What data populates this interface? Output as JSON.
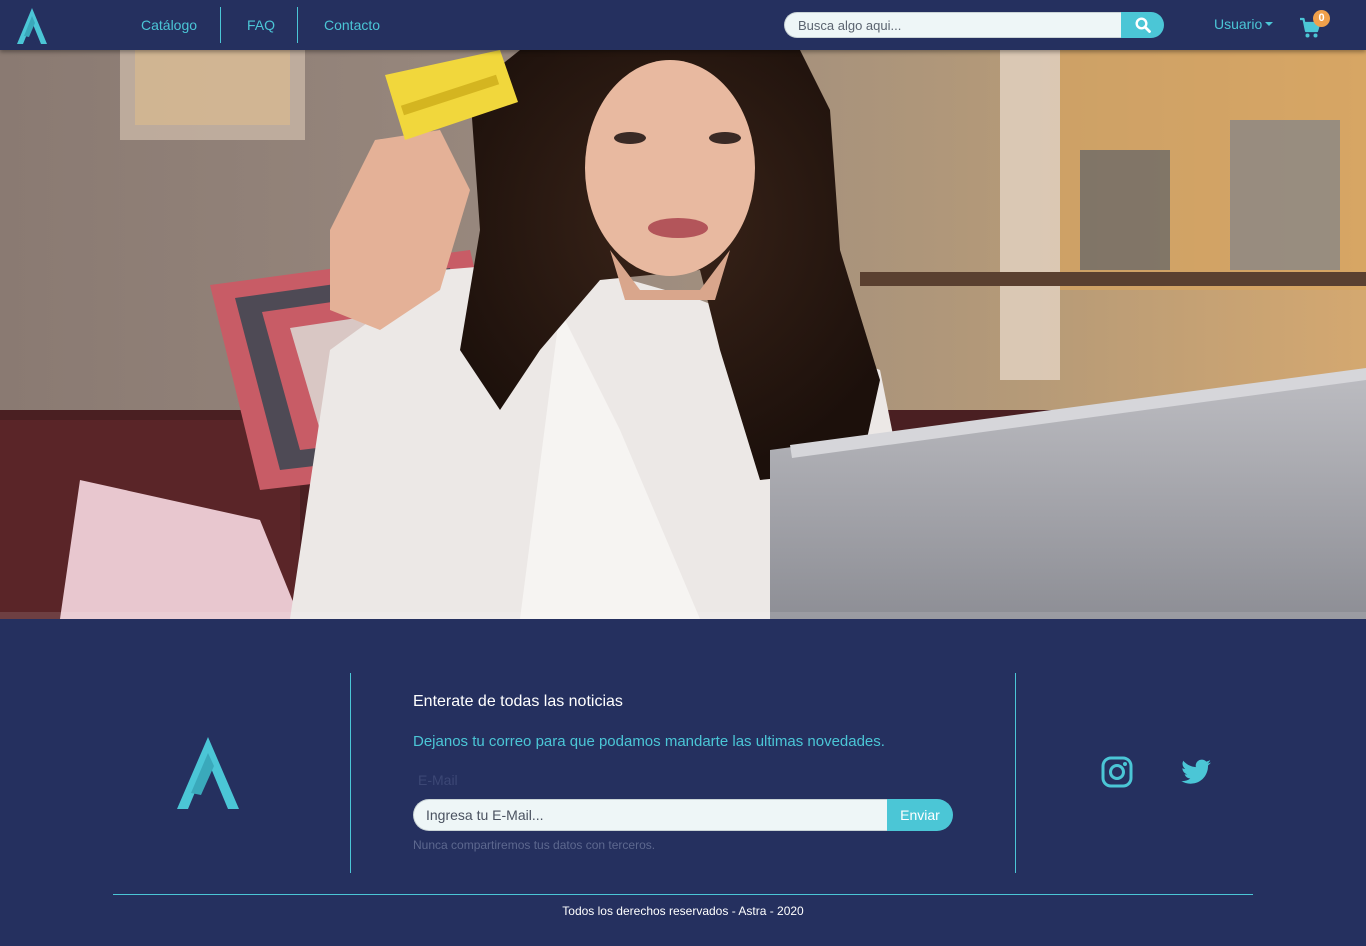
{
  "nav": {
    "links": [
      "Catálogo",
      "FAQ",
      "Contacto"
    ],
    "search_placeholder": "Busca algo aqui...",
    "user_label": "Usuario",
    "cart_count": "0"
  },
  "newsletter": {
    "title": "Enterate de todas las noticias",
    "subtitle": "Dejanos tu correo para que podamos mandarte las ultimas novedades.",
    "email_label": "E-Mail",
    "email_placeholder": "Ingresa tu E-Mail...",
    "send_label": "Enviar",
    "privacy_note": "Nunca compartiremos tus datos con terceros."
  },
  "social": [
    "instagram-icon",
    "twitter-icon"
  ],
  "footer": {
    "copyright": "Todos los derechos reservados - Astra - 2020"
  },
  "colors": {
    "background": "#25305f",
    "accent": "#4bc6d6",
    "badge": "#f0a04b"
  }
}
